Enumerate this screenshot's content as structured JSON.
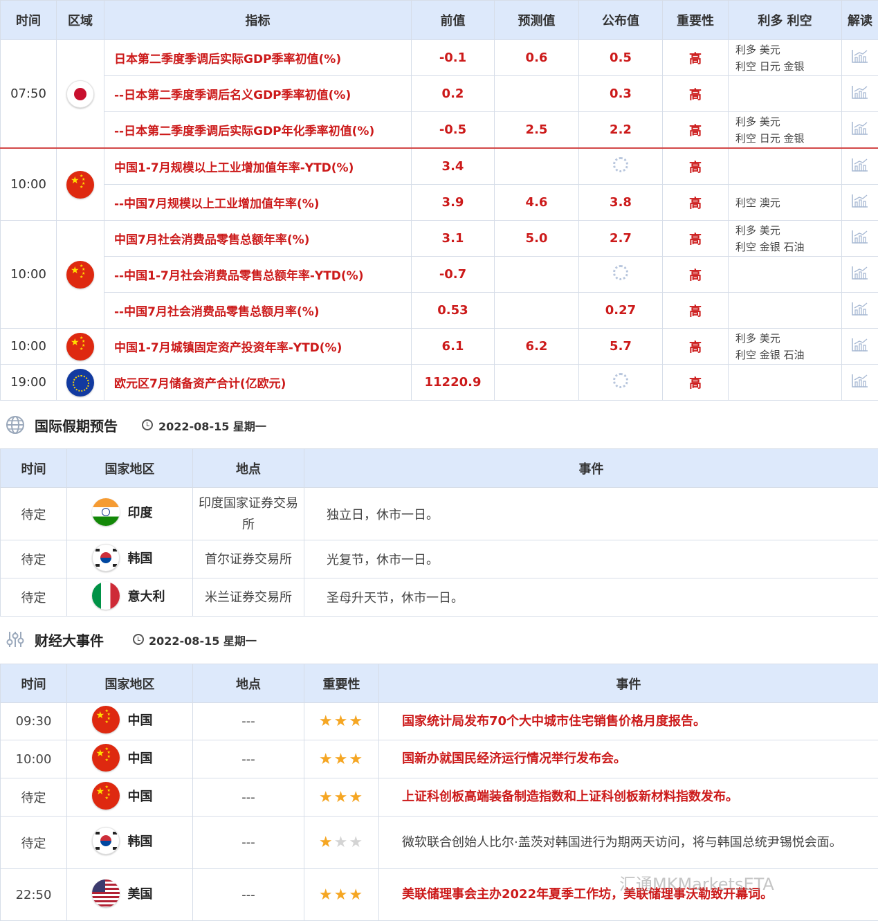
{
  "indicators": {
    "headers": [
      "时间",
      "区域",
      "指标",
      "前值",
      "预测值",
      "公布值",
      "重要性",
      "利多 利空",
      "解读"
    ],
    "groups": [
      {
        "time": "07:50",
        "flag": "japan-flag",
        "rows": [
          {
            "name": "日本第二季度季调后实际GDP季率初值(%)",
            "prev": "-0.1",
            "forecast": "0.6",
            "actual": "0.5",
            "importance": "高",
            "bull": "利多  美元",
            "bear": "利空  日元 金银"
          },
          {
            "name": "--日本第二季度季调后名义GDP季率初值(%)",
            "prev": "0.2",
            "forecast": "",
            "actual": "0.3",
            "importance": "高",
            "bull": "",
            "bear": ""
          },
          {
            "name": "--日本第二季度季调后实际GDP年化季率初值(%)",
            "prev": "-0.5",
            "forecast": "2.5",
            "actual": "2.2",
            "importance": "高",
            "bull": "利多  美元",
            "bear": "利空  日元 金银"
          }
        ]
      },
      {
        "time": "10:00",
        "flag": "china-flag",
        "rows": [
          {
            "name": "中国1-7月规模以上工业增加值年率-YTD(%)",
            "prev": "3.4",
            "forecast": "",
            "actual": "",
            "importance": "高",
            "bull": "",
            "bear": ""
          },
          {
            "name": "--中国7月规模以上工业增加值年率(%)",
            "prev": "3.9",
            "forecast": "4.6",
            "actual": "3.8",
            "importance": "高",
            "bull": "",
            "bear": "利空  澳元"
          }
        ]
      },
      {
        "time": "10:00",
        "flag": "china-flag",
        "rows": [
          {
            "name": "中国7月社会消费品零售总额年率(%)",
            "prev": "3.1",
            "forecast": "5.0",
            "actual": "2.7",
            "importance": "高",
            "bull": "利多  美元",
            "bear": "利空  金银 石油"
          },
          {
            "name": "--中国1-7月社会消费品零售总额年率-YTD(%)",
            "prev": "-0.7",
            "forecast": "",
            "actual": "",
            "importance": "高",
            "bull": "",
            "bear": ""
          },
          {
            "name": "--中国7月社会消费品零售总额月率(%)",
            "prev": "0.53",
            "forecast": "",
            "actual": "0.27",
            "importance": "高",
            "bull": "",
            "bear": ""
          }
        ]
      },
      {
        "time": "10:00",
        "flag": "china-flag",
        "rows": [
          {
            "name": "中国1-7月城镇固定资产投资年率-YTD(%)",
            "prev": "6.1",
            "forecast": "6.2",
            "actual": "5.7",
            "importance": "高",
            "bull": "利多  美元",
            "bear": "利空  金银 石油"
          }
        ]
      },
      {
        "time": "19:00",
        "flag": "eu-flag",
        "rows": [
          {
            "name": "欧元区7月储备资产合计(亿欧元)",
            "prev": "11220.9",
            "forecast": "",
            "actual": "",
            "importance": "高",
            "bull": "",
            "bear": ""
          }
        ]
      }
    ]
  },
  "holidays": {
    "title": "国际假期预告",
    "date": "2022-08-15 星期一",
    "headers": [
      "时间",
      "国家地区",
      "地点",
      "事件"
    ],
    "rows": [
      {
        "time": "待定",
        "country": "印度",
        "flag": "india-flag",
        "place": "印度国家证券交易所",
        "event": "独立日，休市一日。"
      },
      {
        "time": "待定",
        "country": "韩国",
        "flag": "korea-flag",
        "place": "首尔证券交易所",
        "event": "光复节，休市一日。"
      },
      {
        "time": "待定",
        "country": "意大利",
        "flag": "italy-flag",
        "place": "米兰证券交易所",
        "event": "圣母升天节，休市一日。"
      }
    ]
  },
  "events": {
    "title": "财经大事件",
    "date": "2022-08-15 星期一",
    "headers": [
      "时间",
      "国家地区",
      "地点",
      "重要性",
      "事件"
    ],
    "rows": [
      {
        "time": "09:30",
        "country": "中国",
        "flag": "china-flag",
        "place": "---",
        "stars": 3,
        "event": "国家统计局发布70个大中城市住宅销售价格月度报告。",
        "highlight": true
      },
      {
        "time": "10:00",
        "country": "中国",
        "flag": "china-flag",
        "place": "---",
        "stars": 3,
        "event": "国新办就国民经济运行情况举行发布会。",
        "highlight": true
      },
      {
        "time": "待定",
        "country": "中国",
        "flag": "china-flag",
        "place": "---",
        "stars": 3,
        "event": "上证科创板高端装备制造指数和上证科创板新材料指数发布。",
        "highlight": true
      },
      {
        "time": "待定",
        "country": "韩国",
        "flag": "korea-flag",
        "place": "---",
        "stars": 1,
        "event": "微软联合创始人比尔·盖茨对韩国进行为期两天访问，将与韩国总统尹锡悦会面。",
        "highlight": false
      },
      {
        "time": "22:50",
        "country": "美国",
        "flag": "usa-flag",
        "place": "---",
        "stars": 3,
        "event": "美联储理事会主办2022年夏季工作坊，美联储理事沃勒致开幕词。",
        "highlight": true
      }
    ]
  },
  "watermark": "汇通MKMarketsETA",
  "colors": {
    "header_bg": "#dde9fb",
    "accent_red": "#cc1a1a",
    "border": "#d6dde8",
    "star": "#f5a623"
  }
}
